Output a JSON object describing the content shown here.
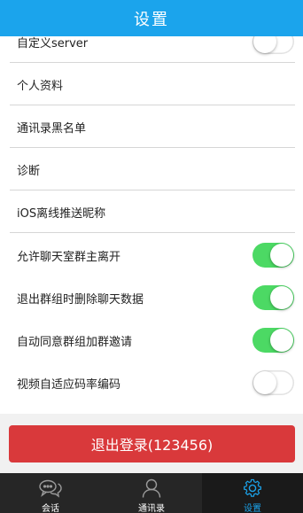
{
  "header": {
    "title": "设置"
  },
  "settings": [
    {
      "label": "自定义server",
      "toggle": "off"
    },
    {
      "label": "个人资料"
    },
    {
      "label": "通讯录黑名单"
    },
    {
      "label": "诊断"
    },
    {
      "label": "iOS离线推送昵称"
    },
    {
      "label": "允许聊天室群主离开",
      "toggle": "on"
    },
    {
      "label": "退出群组时删除聊天数据",
      "toggle": "on"
    },
    {
      "label": "自动同意群组加群邀请",
      "toggle": "on"
    },
    {
      "label": "视频自适应码率编码",
      "toggle": "off"
    }
  ],
  "logout_label": "退出登录(123456)",
  "tabs": [
    {
      "label": "会话",
      "icon": "chat-bubbles-icon",
      "active": false
    },
    {
      "label": "通讯录",
      "icon": "contact-person-icon",
      "active": false
    },
    {
      "label": "设置",
      "icon": "gear-icon",
      "active": true
    }
  ],
  "colors": {
    "nav_bar": "#1ba4ec",
    "toggle_on": "#4cd964",
    "logout_button": "#d9393b",
    "tab_bar": "#262626",
    "tab_active": "#1ba4ec"
  }
}
